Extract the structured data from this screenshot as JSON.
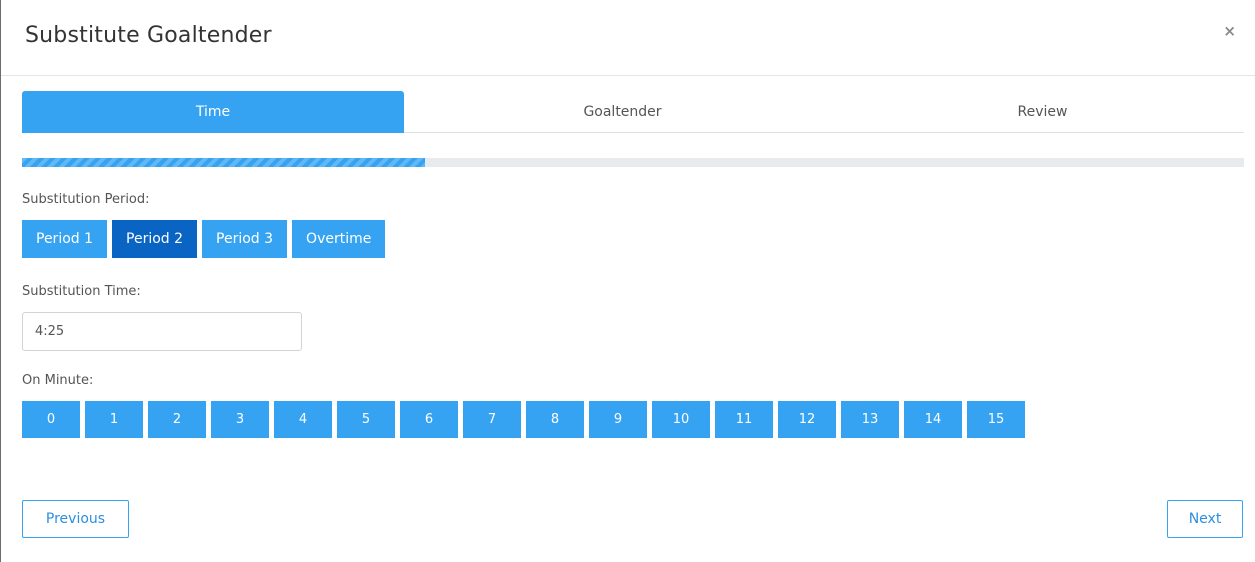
{
  "modal": {
    "title": "Substitute Goaltender",
    "close_label": "×"
  },
  "tabs": [
    {
      "label": "Time",
      "active": true
    },
    {
      "label": "Goaltender",
      "active": false
    },
    {
      "label": "Review",
      "active": false
    }
  ],
  "progress": {
    "percent": 33
  },
  "period": {
    "label": "Substitution Period:",
    "options": [
      {
        "label": "Period 1",
        "selected": false
      },
      {
        "label": "Period 2",
        "selected": true
      },
      {
        "label": "Period 3",
        "selected": false
      },
      {
        "label": "Overtime",
        "selected": false
      }
    ]
  },
  "time": {
    "label": "Substitution Time:",
    "value": "4:25"
  },
  "minute": {
    "label": "On Minute:",
    "options": [
      "0",
      "1",
      "2",
      "3",
      "4",
      "5",
      "6",
      "7",
      "8",
      "9",
      "10",
      "11",
      "12",
      "13",
      "14",
      "15"
    ]
  },
  "nav": {
    "previous_label": "Previous",
    "next_label": "Next"
  },
  "colors": {
    "accent": "#36a3f2",
    "selected": "#0a64c4"
  }
}
